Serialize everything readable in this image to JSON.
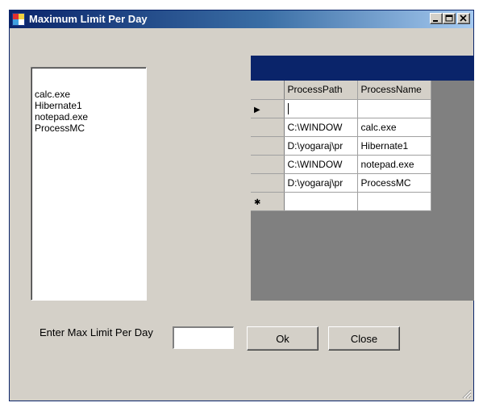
{
  "window": {
    "title": "Maximum Limit Per Day",
    "icon": "app-window-icon",
    "controls": {
      "minimize": "minimize-icon",
      "maximize": "maximize-icon",
      "close": "close-icon"
    }
  },
  "process_list": {
    "items": [
      "calc.exe",
      "Hibernate1",
      "notepad.exe",
      "ProcessMC"
    ]
  },
  "grid": {
    "columns": [
      "ProcessPath",
      "ProcessName"
    ],
    "rows": [
      {
        "path": "C:\\WINDOW",
        "name": "calc.exe"
      },
      {
        "path": "D:\\yogaraj\\pr",
        "name": "Hibernate1"
      },
      {
        "path": "C:\\WINDOW",
        "name": "notepad.exe"
      },
      {
        "path": "D:\\yogaraj\\pr",
        "name": "ProcessMC"
      }
    ],
    "current_row_marker": "▶",
    "new_row_marker": "✱"
  },
  "form": {
    "max_limit_label": "Enter Max Limit Per Day",
    "max_limit_value": "",
    "ok_label": "Ok",
    "close_label": "Close"
  }
}
